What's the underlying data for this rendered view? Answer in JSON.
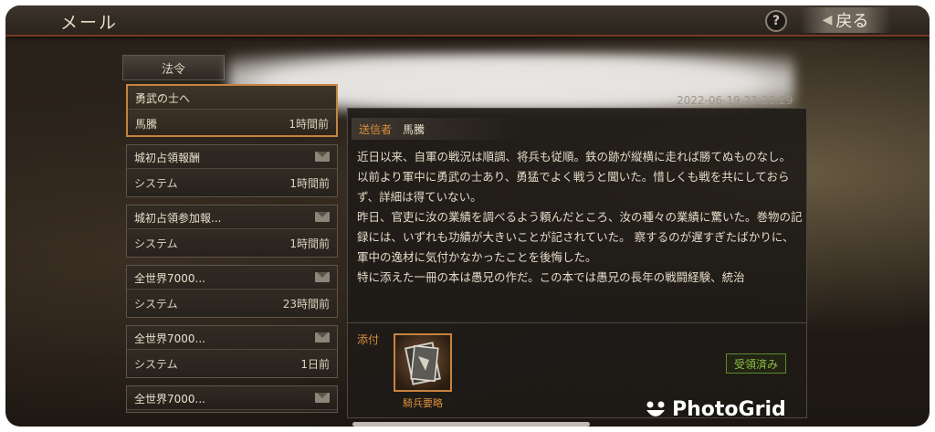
{
  "header": {
    "title": "メール",
    "help_label": "?",
    "back_label": "戻る"
  },
  "tabs": [
    {
      "label": "法令"
    }
  ],
  "mail_list": [
    {
      "subject": "勇武の士へ",
      "sender": "馬騰",
      "time": "1時間前",
      "selected": true
    },
    {
      "subject": "城初占領報酬",
      "sender": "システム",
      "time": "1時間前"
    },
    {
      "subject": "城初占領参加報...",
      "sender": "システム",
      "time": "1時間前"
    },
    {
      "subject": "全世界7000...",
      "sender": "システム",
      "time": "23時間前"
    },
    {
      "subject": "全世界7000...",
      "sender": "システム",
      "time": "1日前"
    },
    {
      "subject": "全世界7000...",
      "sender": "",
      "time": ""
    }
  ],
  "detail": {
    "timestamp": "2022-06-19 22:21:29",
    "sender_label": "送信者",
    "sender_name": "馬騰",
    "paragraphs": [
      "近日以来、自軍の戦況は順調、将兵も従順。鉄の跡が縦横に走れば勝てぬものなし。",
      "以前より軍中に勇武の士あり、勇猛でよく戦うと聞いた。惜しくも戦を共にしておらず、詳細は得ていない。",
      "昨日、官吏に汝の業績を調べるよう頼んだところ、汝の種々の業績に驚いた。巻物の記録には、いずれも功績が大きいことが記されていた。 察するのが遅すぎたばかりに、軍中の逸材に気付かなかったことを後悔した。",
      "特に添えた一冊の本は愚兄の作だ。この本では愚兄の長年の戦闘経験、統治"
    ],
    "attachment_label": "添付",
    "attachment_name": "騎兵要略",
    "claimed_label": "受領済み"
  },
  "watermark": {
    "text": "PhotoGrid"
  }
}
